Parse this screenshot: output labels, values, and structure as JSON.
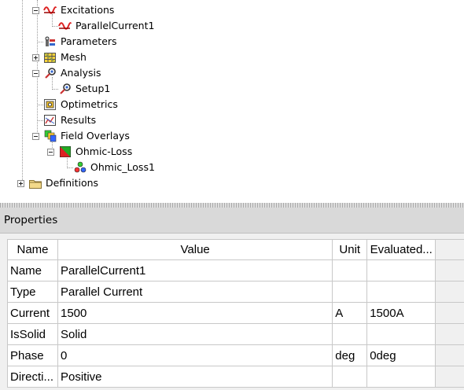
{
  "tree": {
    "excitations": "Excitations",
    "parallel_current": "ParallelCurrent1",
    "parameters": "Parameters",
    "mesh": "Mesh",
    "analysis": "Analysis",
    "setup": "Setup1",
    "optimetrics": "Optimetrics",
    "results": "Results",
    "field_overlays": "Field Overlays",
    "ohmic_loss": "Ohmic-Loss",
    "ohmic_loss_plot": "Ohmic_Loss1",
    "definitions": "Definitions"
  },
  "properties": {
    "title": "Properties",
    "columns": {
      "name": "Name",
      "value": "Value",
      "unit": "Unit",
      "evaluated": "Evaluated..."
    },
    "rows": [
      {
        "name": "Name",
        "value": "ParallelCurrent1",
        "unit": "",
        "evaluated": ""
      },
      {
        "name": "Type",
        "value": "Parallel Current",
        "unit": "",
        "evaluated": ""
      },
      {
        "name": "Current",
        "value": "1500",
        "unit": "A",
        "evaluated": "1500A"
      },
      {
        "name": "IsSolid",
        "value": "Solid",
        "unit": "",
        "evaluated": ""
      },
      {
        "name": "Phase",
        "value": "0",
        "unit": "deg",
        "evaluated": "0deg"
      },
      {
        "name": "Directi...",
        "value": "Positive",
        "unit": "",
        "evaluated": ""
      }
    ]
  },
  "icons": {
    "excitations": "excitation-icon",
    "parameters": "parameters-icon",
    "mesh": "mesh-icon",
    "analysis": "analysis-icon",
    "optimetrics": "optimetrics-icon",
    "results": "results-icon",
    "field_overlays": "field-overlays-icon",
    "definitions": "folder-icon"
  }
}
